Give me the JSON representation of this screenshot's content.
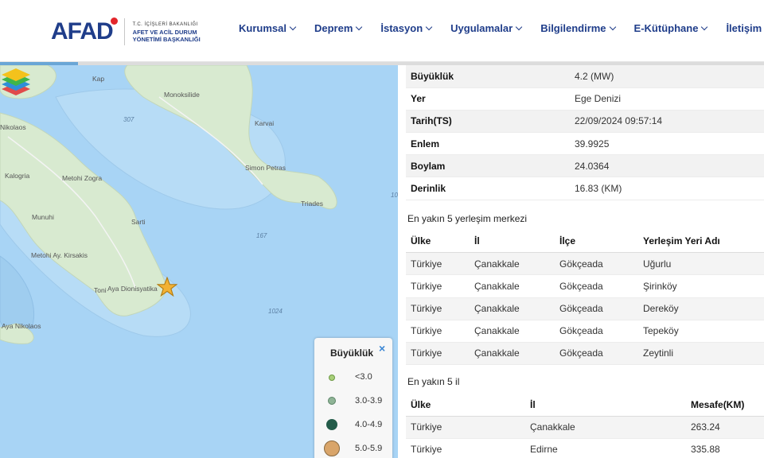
{
  "header": {
    "logo": {
      "word": "AFAD",
      "line1": "T.C. İÇİŞLERİ BAKANLIĞI",
      "line2": "AFET VE ACİL DURUM",
      "line3": "YÖNETİMİ BAŞKANLIĞI"
    },
    "nav": [
      "Kurumsal",
      "Deprem",
      "İstasyon",
      "Uygulamalar",
      "Bilgilendirme",
      "E-Kütüphane",
      "İletişim"
    ]
  },
  "map": {
    "labels": [
      "Kap",
      "Monoksilide",
      "Nikolaos",
      "307",
      "Karvai",
      "Kalogria",
      "Metohi Zogra",
      "Simon Petras",
      "Triades",
      "Munuhi",
      "Sarti",
      "167",
      "Metohi Ay. Kirsakis",
      "Aya Dionisyatika",
      "Toni",
      "1024",
      "Aya Nikolaos",
      "10"
    ],
    "epicenter_icon": "star-icon",
    "layers_icon": "layers-icon",
    "legend": {
      "title": "Büyüklük",
      "close": "×",
      "items": [
        {
          "label": "<3.0",
          "color": "#a9cf7a"
        },
        {
          "label": "3.0-3.9",
          "color": "#8fb496"
        },
        {
          "label": "4.0-4.9",
          "color": "#245c4a"
        },
        {
          "label": "5.0-5.9",
          "color": "#d9a56a"
        }
      ]
    }
  },
  "details": [
    {
      "key": "Büyüklük",
      "value": "4.2 (MW)"
    },
    {
      "key": "Yer",
      "value": "Ege Denizi"
    },
    {
      "key": "Tarih(TS)",
      "value": "22/09/2024 09:57:14"
    },
    {
      "key": "Enlem",
      "value": "39.9925"
    },
    {
      "key": "Boylam",
      "value": "24.0364"
    },
    {
      "key": "Derinlik",
      "value": "16.83 (KM)"
    }
  ],
  "settlements": {
    "title": "En yakın 5 yerleşim merkezi",
    "headers": [
      "Ülke",
      "İl",
      "İlçe",
      "Yerleşim Yeri Adı"
    ],
    "rows": [
      [
        "Türkiye",
        "Çanakkale",
        "Gökçeada",
        "Uğurlu"
      ],
      [
        "Türkiye",
        "Çanakkale",
        "Gökçeada",
        "Şirinköy"
      ],
      [
        "Türkiye",
        "Çanakkale",
        "Gökçeada",
        "Dereköy"
      ],
      [
        "Türkiye",
        "Çanakkale",
        "Gökçeada",
        "Tepeköy"
      ],
      [
        "Türkiye",
        "Çanakkale",
        "Gökçeada",
        "Zeytinli"
      ]
    ]
  },
  "provinces": {
    "title": "En yakın 5 il",
    "headers": [
      "Ülke",
      "İl",
      "Mesafe(KM)"
    ],
    "rows": [
      [
        "Türkiye",
        "Çanakkale",
        "263.24"
      ],
      [
        "Türkiye",
        "Edirne",
        "335.88"
      ]
    ]
  }
}
